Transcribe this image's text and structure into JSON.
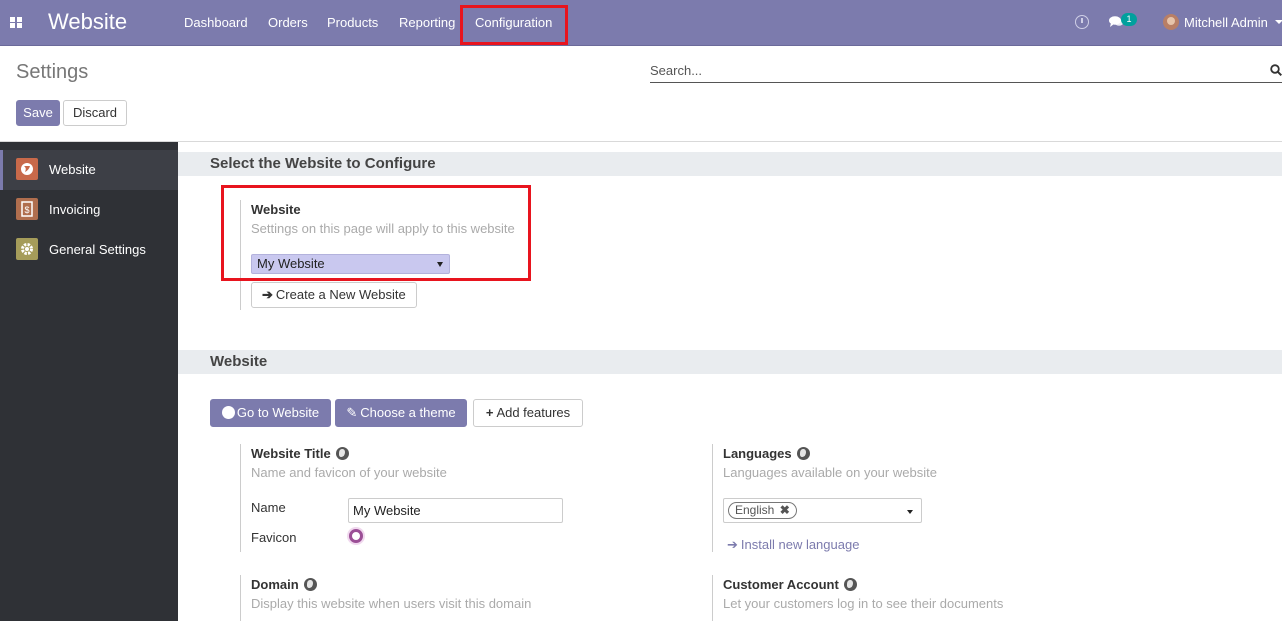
{
  "navbar": {
    "app_name": "Website",
    "menu": [
      "Dashboard",
      "Orders",
      "Products",
      "Reporting",
      "Configuration"
    ],
    "messages_count": "1",
    "user_name": "Mitchell Admin",
    "accent_color": "#7c7bad",
    "highlight_color": "#e8141e"
  },
  "control_panel": {
    "title": "Settings",
    "search_placeholder": "Search...",
    "save_label": "Save",
    "discard_label": "Discard"
  },
  "sidebar": {
    "items": [
      {
        "label": "Website",
        "icon": "website-globe-icon",
        "color": "#c8694a",
        "active": true
      },
      {
        "label": "Invoicing",
        "icon": "invoice-dollar-icon",
        "color": "#b06e4e",
        "active": false
      },
      {
        "label": "General Settings",
        "icon": "gear-icon",
        "color": "#a59c5a",
        "active": false
      }
    ]
  },
  "select_section": {
    "title": "Select the Website to Configure",
    "setting_title": "Website",
    "setting_desc": "Settings on this page will apply to this website",
    "selected_website": "My Website",
    "create_label": "Create a New Website"
  },
  "website_section": {
    "title": "Website",
    "go_to_website": "Go to Website",
    "choose_theme": "Choose a theme",
    "add_features": "Add features",
    "website_title": {
      "title": "Website Title",
      "desc": "Name and favicon of your website",
      "name_label": "Name",
      "name_value": "My Website",
      "favicon_label": "Favicon"
    },
    "languages": {
      "title": "Languages",
      "desc": "Languages available on your website",
      "tag": "English",
      "install_link": "Install new language"
    },
    "domain": {
      "title": "Domain",
      "desc": "Display this website when users visit this domain"
    },
    "customer_account": {
      "title": "Customer Account",
      "desc": "Let your customers log in to see their documents"
    }
  }
}
